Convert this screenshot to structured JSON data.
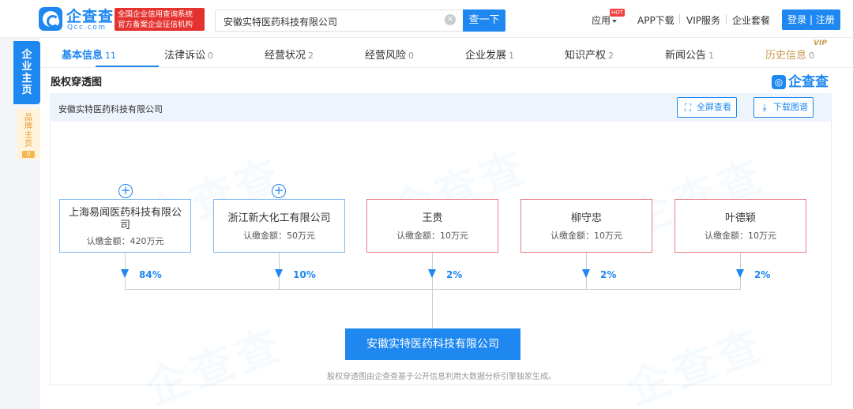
{
  "header": {
    "logo_text": "企查查",
    "logo_sub": "Qcc.com",
    "cert_line1": "全国企业信用查询系统",
    "cert_line2": "官方备案企业征信机构",
    "search_value": "安徽实特医药科技有限公司",
    "search_button": "查一下",
    "nav": {
      "apps": "应用",
      "apps_badge": "HOT",
      "app_download": "APP下载",
      "vip": "VIP服务",
      "enterprise": "企业套餐",
      "login": "登录 | 注册"
    }
  },
  "side_tabs": {
    "main": "企业主页",
    "brand": "品牌主页",
    "brand_count": "0"
  },
  "tabs": [
    {
      "label": "基本信息",
      "count": "11",
      "active": true
    },
    {
      "label": "法律诉讼",
      "count": "0"
    },
    {
      "label": "经营状况",
      "count": "2"
    },
    {
      "label": "经营风险",
      "count": "0"
    },
    {
      "label": "企业发展",
      "count": "1"
    },
    {
      "label": "知识产权",
      "count": "2"
    },
    {
      "label": "新闻公告",
      "count": "1"
    },
    {
      "label": "历史信息",
      "count": "0",
      "vip": "VIP"
    }
  ],
  "section": {
    "title": "股权穿透图",
    "brand_logo": "企查查",
    "company": "安徽实特医药科技有限公司",
    "fullscreen_button": "全屏查看",
    "download_button": "下载图谱"
  },
  "shareholders": [
    {
      "name": "上海易闻医药科技有限公司",
      "amount": "认缴金额：420万元",
      "percent": "84%",
      "type": "company",
      "expandable": true
    },
    {
      "name": "浙江新大化工有限公司",
      "amount": "认缴金额：50万元",
      "percent": "10%",
      "type": "company",
      "expandable": true
    },
    {
      "name": "王贵",
      "amount": "认缴金额：10万元",
      "percent": "2%",
      "type": "person",
      "expandable": false
    },
    {
      "name": "柳守忠",
      "amount": "认缴金额：10万元",
      "percent": "2%",
      "type": "person",
      "expandable": false
    },
    {
      "name": "叶德颖",
      "amount": "认缴金额：10万元",
      "percent": "2%",
      "type": "person",
      "expandable": false
    }
  ],
  "target_company": "安徽实特医药科技有限公司",
  "footnote": "股权穿透图由企查查基于公开信息利用大数据分析引擎独家生成。",
  "icons": {
    "expand": "plus-circle-icon",
    "arrow": "arrow-down-icon",
    "fullscreen": "fullscreen-icon",
    "download": "download-icon"
  },
  "colors": {
    "accent": "#1e87f0",
    "person_border": "#ec7c84",
    "company_border": "#7fb8ee",
    "badge_red": "#e5322e"
  }
}
